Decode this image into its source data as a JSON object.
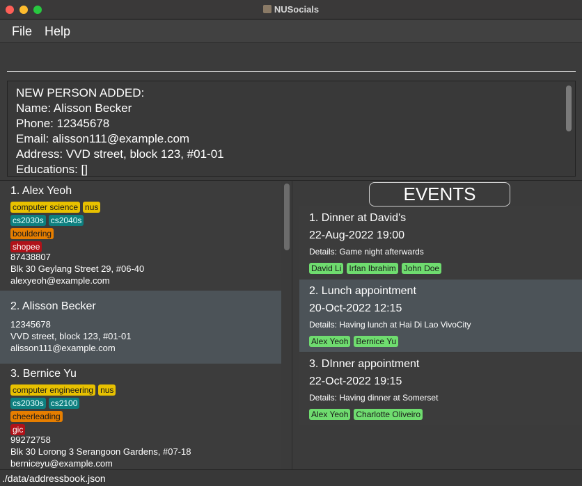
{
  "window": {
    "title": "NUSocials"
  },
  "menu": {
    "file": "File",
    "help": "Help"
  },
  "command": {
    "value": "",
    "placeholder": ""
  },
  "result": {
    "lines": [
      "NEW PERSON ADDED:",
      "Name: Alisson Becker",
      "Phone: 12345678",
      "Email: alisson111@example.com",
      "Address: VVD street, block 123, #01-01",
      "Educations: []"
    ]
  },
  "persons": [
    {
      "name": "1.  Alex Yeoh",
      "educations": [
        "computer science",
        "nus"
      ],
      "modules": [
        "cs2030s",
        "cs2040s"
      ],
      "ccas": [
        "bouldering"
      ],
      "interests": [
        "shopee"
      ],
      "phone": "87438807",
      "address": "Blk 30 Geylang Street 29, #06-40",
      "email": "alexyeoh@example.com"
    },
    {
      "name": "2.  Alisson Becker",
      "phone": "12345678",
      "address": "VVD street, block 123, #01-01",
      "email": "alisson111@example.com"
    },
    {
      "name": "3.  Bernice Yu",
      "educations": [
        "computer engineering",
        "nus"
      ],
      "modules": [
        "cs2030s",
        "cs2100"
      ],
      "ccas": [
        "cheerleading"
      ],
      "interests": [
        "gic"
      ],
      "phone": "99272758",
      "address": "Blk 30 Lorong 3 Serangoon Gardens, #07-18",
      "email": "berniceyu@example.com"
    }
  ],
  "events_header": "EVENTS",
  "events": [
    {
      "title": "1.  Dinner at David's",
      "datetime": "22-Aug-2022 19:00",
      "details": "Details: Game night afterwards",
      "participants": [
        "David Li",
        "Irfan Ibrahim",
        "John Doe"
      ]
    },
    {
      "title": "2.  Lunch appointment",
      "datetime": "20-Oct-2022 12:15",
      "details": "Details: Having lunch at Hai Di Lao VivoCity",
      "participants": [
        "Alex Yeoh",
        "Bernice Yu"
      ]
    },
    {
      "title": "3.  DInner appointment",
      "datetime": "22-Oct-2022 19:15",
      "details": "Details: Having dinner at Somerset",
      "participants": [
        "Alex Yeoh",
        "Charlotte Oliveiro"
      ]
    }
  ],
  "status": {
    "path": "./data/addressbook.json"
  }
}
